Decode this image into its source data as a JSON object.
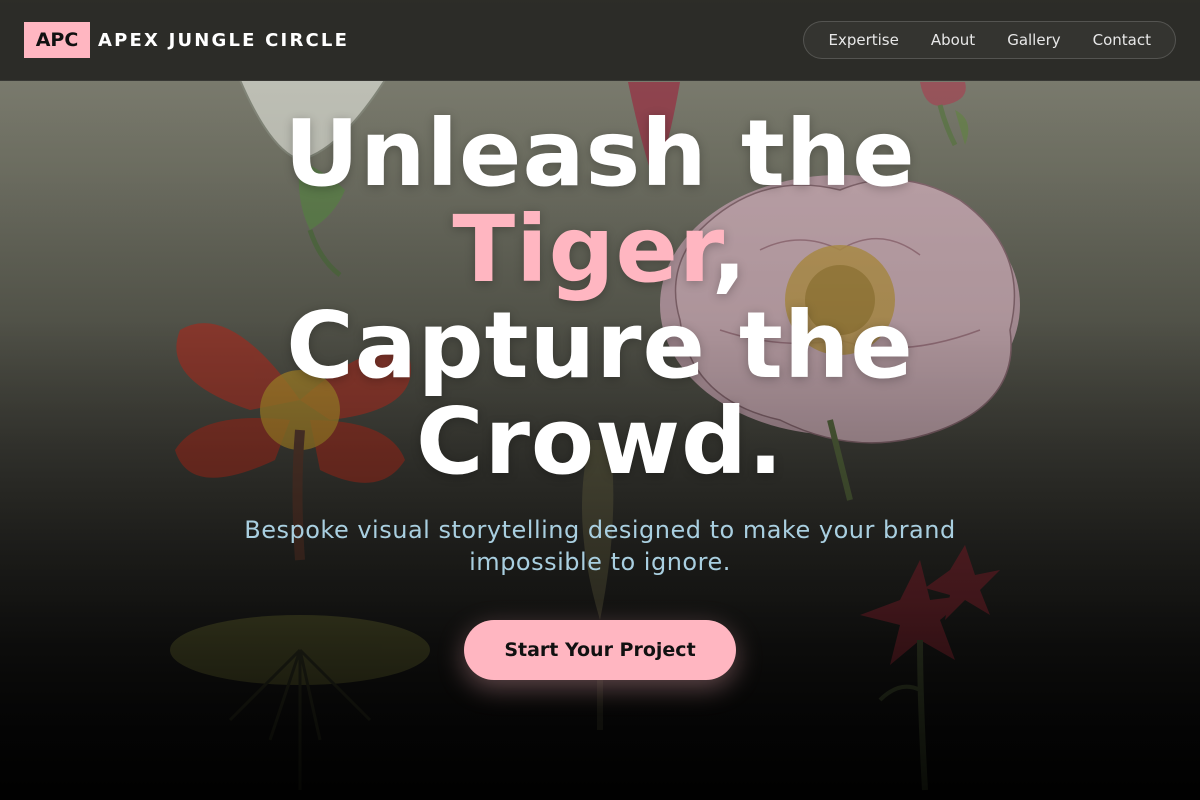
{
  "brand": {
    "mark": "APC",
    "name": "APEX JUNGLE CIRCLE"
  },
  "nav": {
    "items": [
      {
        "label": "Expertise"
      },
      {
        "label": "About"
      },
      {
        "label": "Gallery"
      },
      {
        "label": "Contact"
      }
    ]
  },
  "hero": {
    "headline_line1": "Unleash the",
    "headline_accent": "Tiger",
    "headline_comma": ",",
    "headline_line3": "Capture the",
    "headline_line4": "Crowd.",
    "subtitle": "Bespoke visual storytelling designed to make your brand impossible to ignore.",
    "cta_label": "Start Your Project"
  },
  "colors": {
    "accent": "#ffb6c1",
    "subtitle": "#a9cfe0",
    "header_bg": "#262622",
    "text": "#ffffff"
  }
}
